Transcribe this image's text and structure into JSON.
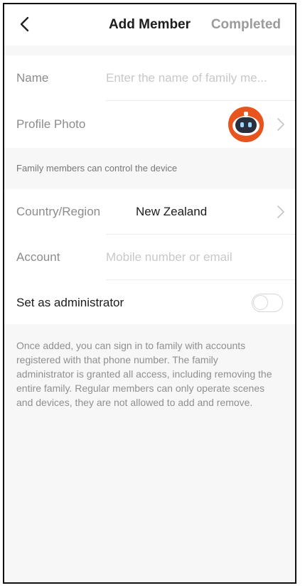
{
  "header": {
    "back_icon": "chevron-left-icon",
    "title": "Add Member",
    "completed_label": "Completed"
  },
  "form": {
    "name": {
      "label": "Name",
      "placeholder": "Enter the name of family me..."
    },
    "profile_photo": {
      "label": "Profile Photo",
      "avatar_icon": "robot-avatar-icon",
      "accent_color": "#e8541e"
    },
    "notice": "Family members can control the device",
    "country": {
      "label": "Country/Region",
      "value": "New Zealand"
    },
    "account": {
      "label": "Account",
      "placeholder": "Mobile number or email"
    },
    "administrator": {
      "label": "Set as administrator",
      "enabled": false
    }
  },
  "help_text": "Once added, you can sign in to family with accounts registered with that phone number. The family administrator is granted all access, including removing the entire family. Regular members can only operate scenes and devices, they are not allowed to add and remove."
}
